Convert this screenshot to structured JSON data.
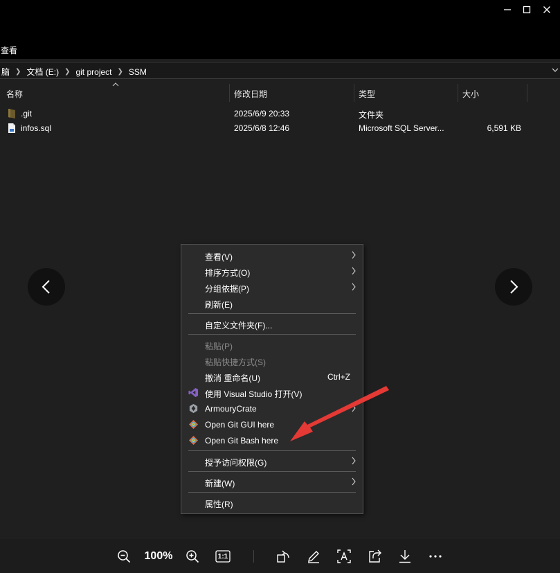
{
  "window": {
    "minimize_icon": "minimize-icon",
    "maximize_icon": "maximize-icon",
    "close_icon": "close-icon"
  },
  "toolbar": {
    "view_label": "查看"
  },
  "breadcrumb": {
    "items": [
      "脑",
      "文档 (E:)",
      "git project",
      "SSM"
    ]
  },
  "columns": {
    "name": "名称",
    "date": "修改日期",
    "type": "类型",
    "size": "大小"
  },
  "files": [
    {
      "name": ".git",
      "date": "2025/6/9 20:33",
      "type": "文件夹",
      "size": "",
      "icon": "folder-icon"
    },
    {
      "name": "infos.sql",
      "date": "2025/6/8 12:46",
      "type": "Microsoft SQL Server...",
      "size": "6,591 KB",
      "icon": "sql-file-icon"
    }
  ],
  "context_menu": {
    "items": [
      {
        "label": "查看(V)",
        "submenu": true
      },
      {
        "label": "排序方式(O)",
        "submenu": true
      },
      {
        "label": "分组依据(P)",
        "submenu": true
      },
      {
        "label": "刷新(E)"
      },
      {
        "label": "自定义文件夹(F)..."
      },
      {
        "label": "粘贴(P)",
        "disabled": true
      },
      {
        "label": "粘贴快捷方式(S)",
        "disabled": true
      },
      {
        "label": "撤消 重命名(U)",
        "shortcut": "Ctrl+Z"
      },
      {
        "label": "使用 Visual Studio 打开(V)",
        "icon": "visual-studio-icon"
      },
      {
        "label": "ArmouryCrate",
        "icon": "armoury-crate-icon",
        "submenu": true
      },
      {
        "label": "Open Git GUI here",
        "icon": "git-gui-icon"
      },
      {
        "label": "Open Git Bash here",
        "icon": "git-bash-icon"
      },
      {
        "label": "授予访问权限(G)",
        "submenu": true
      },
      {
        "label": "新建(W)",
        "submenu": true
      },
      {
        "label": "属性(R)"
      }
    ]
  },
  "viewer": {
    "zoom_level": "100%",
    "actual_size_label": "1:1"
  },
  "colors": {
    "annotation_arrow": "#e53935",
    "menu_background": "#2b2b2b",
    "explorer_background": "#1f1f1f",
    "visual_studio": "#8661c5"
  }
}
